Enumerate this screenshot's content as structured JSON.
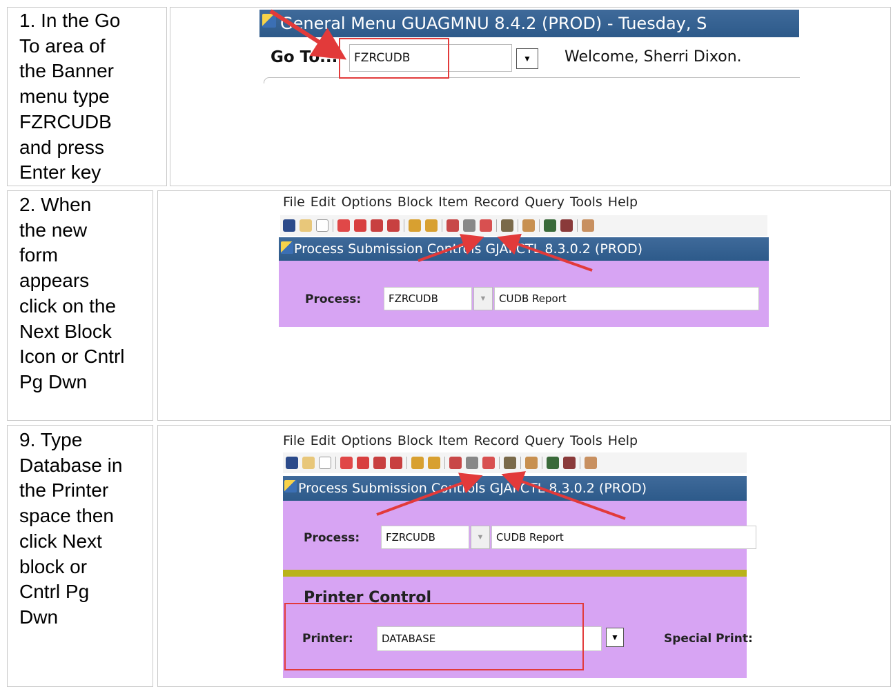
{
  "steps": [
    {
      "text": "1.  In the Go\nTo area of\nthe Banner\nmenu type\nFZRCUDB\nand press\nEnter key",
      "title_bar": "General Menu  GUAGMNU  8.4.2  (PROD) - Tuesday, S",
      "goto_label": "Go To...",
      "goto_value": "FZRCUDB",
      "welcome": "Welcome, Sherri Dixon."
    },
    {
      "text": "2.  When\nthe new\nform\nappears\nclick on the\nNext Block\nIcon or Cntrl\nPg Dwn",
      "menu": [
        "File",
        "Edit",
        "Options",
        "Block",
        "Item",
        "Record",
        "Query",
        "Tools",
        "Help"
      ],
      "title_bar": "Process Submission Controls  GJAPCTL  8.3.0.2  (PROD)",
      "process_label": "Process:",
      "process_code": "FZRCUDB",
      "process_desc": "CUDB Report"
    },
    {
      "text": "9.  Type\nDatabase in\nthe Printer\nspace then\nclick Next\nblock or\nCntrl Pg\nDwn",
      "menu": [
        "File",
        "Edit",
        "Options",
        "Block",
        "Item",
        "Record",
        "Query",
        "Tools",
        "Help"
      ],
      "title_bar": "Process Submission Controls  GJAPCTL  8.3.0.2  (PROD)",
      "process_label": "Process:",
      "process_code": "FZRCUDB",
      "process_desc": "CUDB Report",
      "section_title": "Printer Control",
      "printer_label": "Printer:",
      "printer_value": "DATABASE",
      "special_print_label": "Special Print:"
    }
  ],
  "colors": {
    "title_bar": "#2d5a8a",
    "form_bg": "#d7a4f3",
    "annotation_red": "#e23a3a",
    "divider_olive": "#b9b31a"
  },
  "icons": [
    "app-icon",
    "save-icon",
    "undo-icon",
    "next-block-icon",
    "previous-block-icon",
    "dropdown-arrow-icon",
    "annotation-arrow-icon"
  ]
}
